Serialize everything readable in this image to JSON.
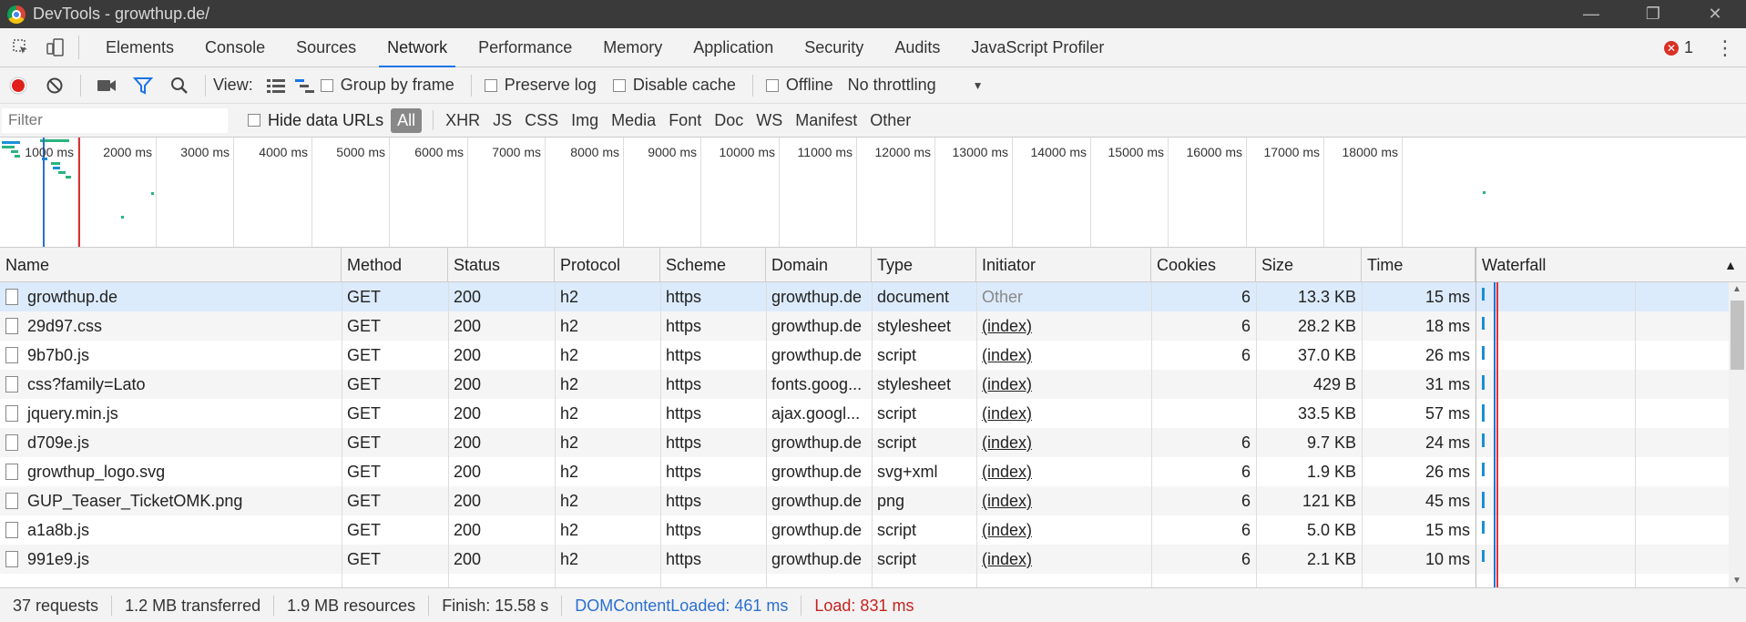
{
  "window": {
    "title": "DevTools - growthup.de/"
  },
  "tabs": [
    {
      "label": "Elements"
    },
    {
      "label": "Console"
    },
    {
      "label": "Sources"
    },
    {
      "label": "Network"
    },
    {
      "label": "Performance"
    },
    {
      "label": "Memory"
    },
    {
      "label": "Application"
    },
    {
      "label": "Security"
    },
    {
      "label": "Audits"
    },
    {
      "label": "JavaScript Profiler"
    }
  ],
  "active_tab": "Network",
  "error_count": "1",
  "toolbar": {
    "view_label": "View:",
    "group_by_frame": "Group by frame",
    "preserve_log": "Preserve log",
    "disable_cache": "Disable cache",
    "offline": "Offline",
    "throttling": "No throttling"
  },
  "filterbar": {
    "filter_placeholder": "Filter",
    "hide_data_urls": "Hide data URLs",
    "types": [
      "All",
      "XHR",
      "JS",
      "CSS",
      "Img",
      "Media",
      "Font",
      "Doc",
      "WS",
      "Manifest",
      "Other"
    ]
  },
  "overview": {
    "ticks": [
      "1000 ms",
      "2000 ms",
      "3000 ms",
      "4000 ms",
      "5000 ms",
      "6000 ms",
      "7000 ms",
      "8000 ms",
      "9000 ms",
      "10000 ms",
      "11000 ms",
      "12000 ms",
      "13000 ms",
      "14000 ms",
      "15000 ms",
      "16000 ms",
      "17000 ms",
      "18000 ms"
    ]
  },
  "table": {
    "columns": [
      "Name",
      "Method",
      "Status",
      "Protocol",
      "Scheme",
      "Domain",
      "Type",
      "Initiator",
      "Cookies",
      "Size",
      "Time",
      "Waterfall"
    ],
    "rows": [
      {
        "name": "growthup.de",
        "method": "GET",
        "status": "200",
        "protocol": "h2",
        "scheme": "https",
        "domain": "growthup.de",
        "type": "document",
        "initiator": "Other",
        "cookies": "6",
        "size": "13.3 KB",
        "time": "15 ms"
      },
      {
        "name": "29d97.css",
        "method": "GET",
        "status": "200",
        "protocol": "h2",
        "scheme": "https",
        "domain": "growthup.de",
        "type": "stylesheet",
        "initiator": "(index)",
        "cookies": "6",
        "size": "28.2 KB",
        "time": "18 ms"
      },
      {
        "name": "9b7b0.js",
        "method": "GET",
        "status": "200",
        "protocol": "h2",
        "scheme": "https",
        "domain": "growthup.de",
        "type": "script",
        "initiator": "(index)",
        "cookies": "6",
        "size": "37.0 KB",
        "time": "26 ms"
      },
      {
        "name": "css?family=Lato",
        "method": "GET",
        "status": "200",
        "protocol": "h2",
        "scheme": "https",
        "domain": "fonts.goog...",
        "type": "stylesheet",
        "initiator": "(index)",
        "cookies": "",
        "size": "429 B",
        "time": "31 ms"
      },
      {
        "name": "jquery.min.js",
        "method": "GET",
        "status": "200",
        "protocol": "h2",
        "scheme": "https",
        "domain": "ajax.googl...",
        "type": "script",
        "initiator": "(index)",
        "cookies": "",
        "size": "33.5 KB",
        "time": "57 ms"
      },
      {
        "name": "d709e.js",
        "method": "GET",
        "status": "200",
        "protocol": "h2",
        "scheme": "https",
        "domain": "growthup.de",
        "type": "script",
        "initiator": "(index)",
        "cookies": "6",
        "size": "9.7 KB",
        "time": "24 ms"
      },
      {
        "name": "growthup_logo.svg",
        "method": "GET",
        "status": "200",
        "protocol": "h2",
        "scheme": "https",
        "domain": "growthup.de",
        "type": "svg+xml",
        "initiator": "(index)",
        "cookies": "6",
        "size": "1.9 KB",
        "time": "26 ms"
      },
      {
        "name": "GUP_Teaser_TicketOMK.png",
        "method": "GET",
        "status": "200",
        "protocol": "h2",
        "scheme": "https",
        "domain": "growthup.de",
        "type": "png",
        "initiator": "(index)",
        "cookies": "6",
        "size": "121 KB",
        "time": "45 ms"
      },
      {
        "name": "a1a8b.js",
        "method": "GET",
        "status": "200",
        "protocol": "h2",
        "scheme": "https",
        "domain": "growthup.de",
        "type": "script",
        "initiator": "(index)",
        "cookies": "6",
        "size": "5.0 KB",
        "time": "15 ms"
      },
      {
        "name": "991e9.js",
        "method": "GET",
        "status": "200",
        "protocol": "h2",
        "scheme": "https",
        "domain": "growthup.de",
        "type": "script",
        "initiator": "(index)",
        "cookies": "6",
        "size": "2.1 KB",
        "time": "10 ms"
      }
    ]
  },
  "statusbar": {
    "requests": "37 requests",
    "transferred": "1.2 MB transferred",
    "resources": "1.9 MB resources",
    "finish": "Finish: 15.58 s",
    "dom_content_loaded": "DOMContentLoaded: 461 ms",
    "load": "Load: 831 ms"
  },
  "colors": {
    "accent": "#1a73e8",
    "load": "#d33333",
    "dcl": "#2a6fd1",
    "error": "#d93025",
    "selected_row": "#dcebfc"
  }
}
